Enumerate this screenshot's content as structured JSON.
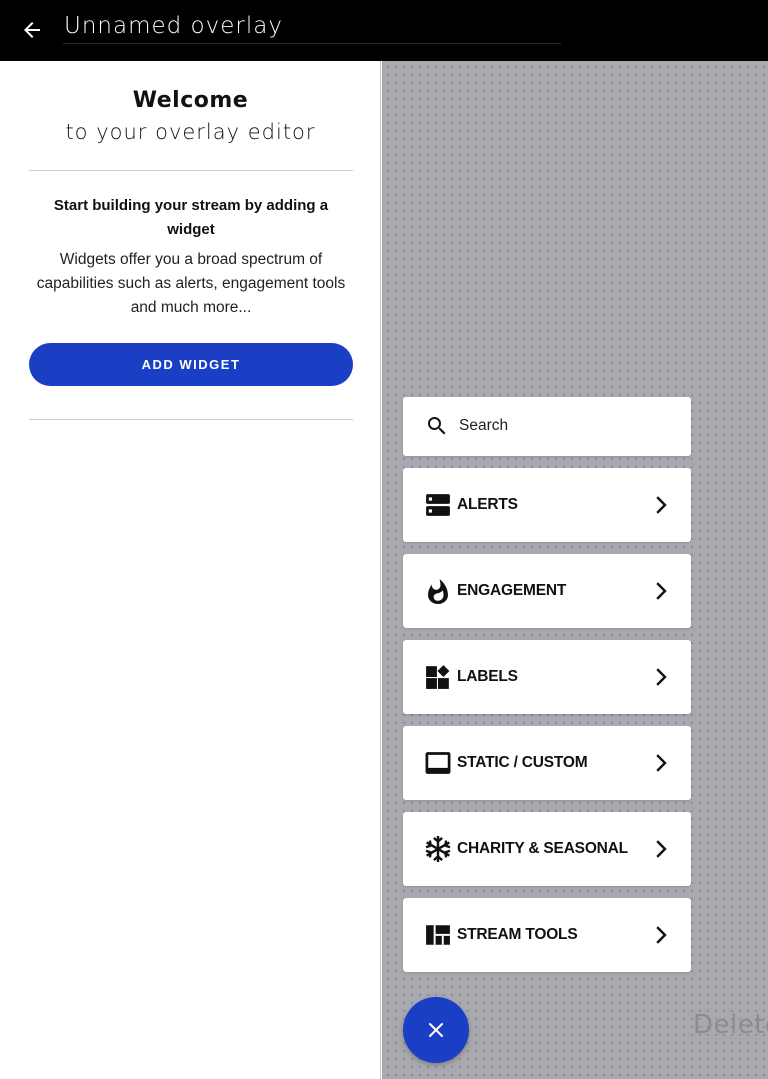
{
  "header": {
    "overlay_name": "Unnamed overlay"
  },
  "welcome": {
    "title": "Welcome",
    "subtitle": "to your overlay editor",
    "start_title": "Start building your stream by adding a widget",
    "description": "Widgets offer you a broad spectrum of capabilities such as alerts, engagement tools and much more...",
    "add_widget_label": "ADD WIDGET"
  },
  "widget_menu": {
    "search_placeholder": "Search",
    "categories": [
      {
        "label": "ALERTS",
        "icon": "alerts-icon"
      },
      {
        "label": "ENGAGEMENT",
        "icon": "flame-icon"
      },
      {
        "label": "LABELS",
        "icon": "widgets-icon"
      },
      {
        "label": "STATIC / CUSTOM",
        "icon": "display-icon"
      },
      {
        "label": "CHARITY & SEASONAL",
        "icon": "snowflake-icon"
      },
      {
        "label": "STREAM TOOLS",
        "icon": "dashboard-icon"
      }
    ]
  },
  "canvas": {
    "delete_hint": "Delete"
  },
  "colors": {
    "accent": "#1a3fc4",
    "topbar": "#000000",
    "canvas": "#a9a9ad"
  }
}
